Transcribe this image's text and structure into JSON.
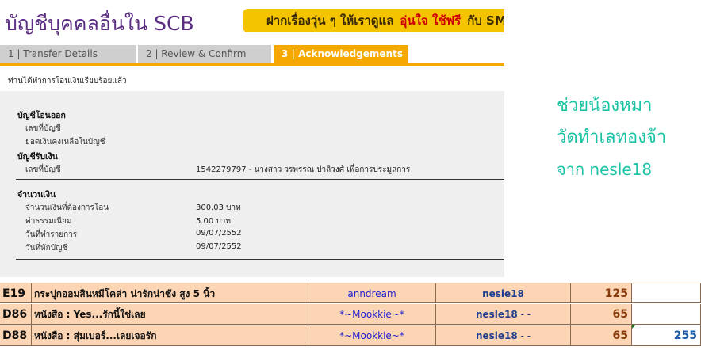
{
  "header": {
    "title": "บัญชีบุคคลอื่นใน SCB",
    "banner": {
      "part1": "ฝากเรื่องวุ่น ๆ ให้เราดูแล",
      "part2": "อุ่นใจ ใช้ฟรี",
      "part3": "กับ SMS"
    }
  },
  "tabs": [
    {
      "label": "1 | Transfer Details"
    },
    {
      "label": "2 | Review & Confirm"
    },
    {
      "label": "3 | Acknowledgements"
    }
  ],
  "status_message": "ท่านได้ทำการโอนเงินเรียบร้อยแล้ว",
  "from_account": {
    "heading": "บัญชีโอนออก",
    "account_no_label": "เลขที่บัญชี",
    "balance_label": "ยอดเงินคงเหลือในบัญชี"
  },
  "to_account": {
    "heading": "บัญชีรับเงิน",
    "account_no_label": "เลขที่บัญชี",
    "account_no_value": "1542279797 - นางสาว วรพรรณ ปาลิวงศ์ เพื่อการประมูลการ"
  },
  "amount": {
    "heading": "จำนวนเงิน",
    "rows": [
      {
        "label": "จำนวนเงินที่ต้องการโอน",
        "value": "300.03 บาท"
      },
      {
        "label": "ค่าธรรมเนียม",
        "value": "5.00 บาท"
      },
      {
        "label": "วันที่ทำรายการ",
        "value": "09/07/2552"
      },
      {
        "label": "วันที่หักบัญชี",
        "value": "09/07/2552"
      }
    ]
  },
  "side_note": {
    "line1": "ช่วยน้องหมา",
    "line2": "วัดทำเลทองจ้า",
    "line3": "จาก nesle18"
  },
  "table": {
    "rows": [
      {
        "code": "E19",
        "item": "กระปุกออมสินหมีโคล่า น่ารักน่าชัง สูง 5 นิ้ว",
        "user": "anndream",
        "nick": "nesle18",
        "nick_suffix": "",
        "amount": "125",
        "total": ""
      },
      {
        "code": "D86",
        "item": "หนังสือ : Yes...รักนี้ใช่เลย",
        "user": "*~Mookkie~*",
        "nick": "nesle18",
        "nick_suffix": " - -",
        "amount": "65",
        "total": ""
      },
      {
        "code": "D88",
        "item": "หนังสือ : สุ่มเบอร์...เลยเจอรัก",
        "user": "*~Mookkie~*",
        "nick": "nesle18",
        "nick_suffix": " - -",
        "amount": "65",
        "total": "255"
      }
    ]
  },
  "colors": {
    "title_purple": "#5a2d82",
    "banner_yellow": "#f5c400",
    "tab_active": "#f5a800",
    "side_note_green": "#19c3a3",
    "table_fill": "#fcd5b4"
  }
}
